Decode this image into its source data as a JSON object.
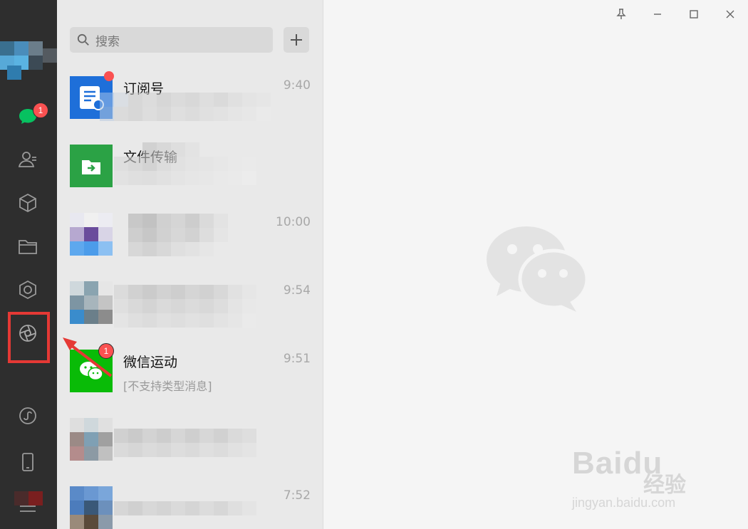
{
  "colors": {
    "nav_bg": "#2e2e2e",
    "list_bg": "#e9e9e9",
    "content_bg": "#f5f5f5",
    "badge": "#fa5151",
    "wechat_green": "#07c160",
    "highlight": "#e53935"
  },
  "nav": {
    "chat_badge": "1",
    "icons": [
      "chat-icon",
      "contacts-icon",
      "favorites-icon",
      "files-icon",
      "moments-icon",
      "channels-icon",
      "mini-programs-icon",
      "phone-icon",
      "menu-icon"
    ]
  },
  "search": {
    "placeholder": "搜索",
    "add_label": "+"
  },
  "chats": [
    {
      "name": "订阅号",
      "time": "9:40",
      "preview": "",
      "has_dot": true
    },
    {
      "name": "文件传输",
      "time": "",
      "preview": ""
    },
    {
      "name": "",
      "time": "10:00",
      "preview": ""
    },
    {
      "name": "",
      "time": "9:54",
      "preview": ""
    },
    {
      "name": "微信运动",
      "time": "9:51",
      "preview": "[不支持类型消息]",
      "badge": "1"
    },
    {
      "name": "",
      "time": "",
      "preview": ""
    },
    {
      "name": "",
      "time": "7:52",
      "preview": ""
    }
  ],
  "window": {
    "controls": [
      "pin-icon",
      "minimize-icon",
      "maximize-icon",
      "close-icon"
    ]
  },
  "watermark": {
    "brand": "Baidu",
    "cn": "经验",
    "url": "jingyan.baidu.com"
  }
}
